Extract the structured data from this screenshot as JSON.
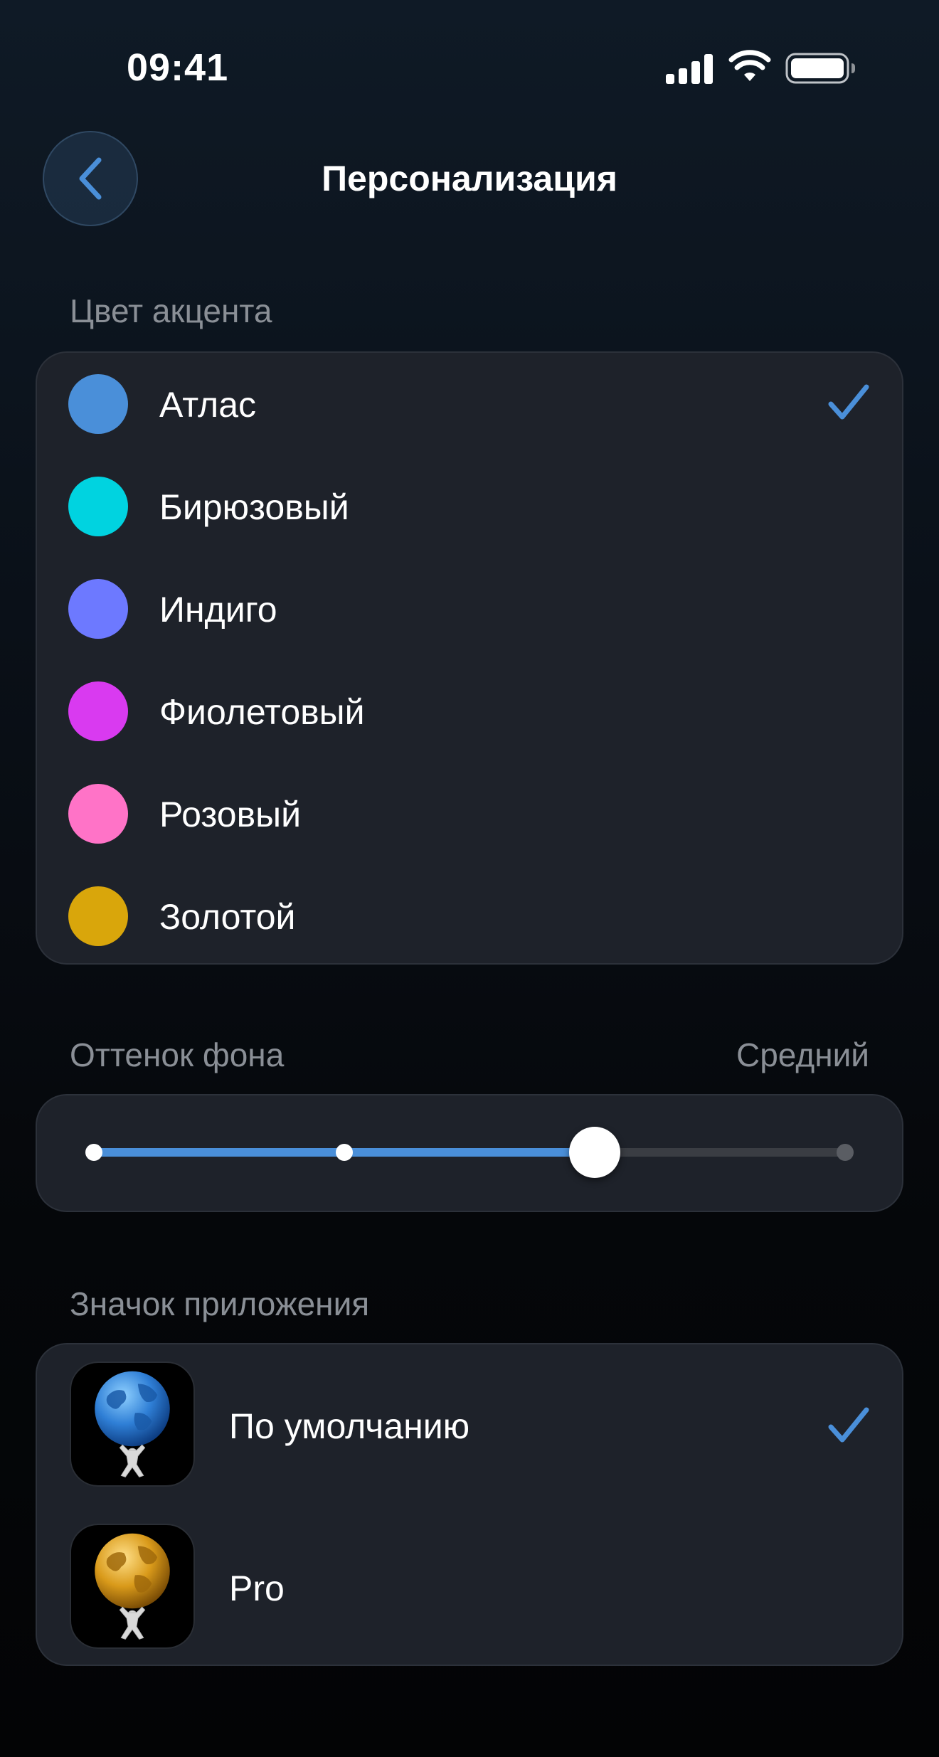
{
  "status_bar": {
    "time": "09:41"
  },
  "nav": {
    "title": "Персонализация"
  },
  "accent": {
    "section_label": "Цвет акцента",
    "selected_index": 0,
    "check_color": "#4a8fd9",
    "options": [
      {
        "label": "Атлас",
        "color": "#4a8fd9"
      },
      {
        "label": "Бирюзовый",
        "color": "#00d3e0"
      },
      {
        "label": "Индиго",
        "color": "#6d79ff"
      },
      {
        "label": "Фиолетовый",
        "color": "#d93af0"
      },
      {
        "label": "Розовый",
        "color": "#ff73c7"
      },
      {
        "label": "Золотой",
        "color": "#d9a60b"
      }
    ]
  },
  "background_tint": {
    "section_label": "Оттенок фона",
    "value_label": "Средний",
    "steps": 4,
    "selected_step": 2,
    "fill_color": "#4a8fd9"
  },
  "app_icon": {
    "section_label": "Значок приложения",
    "selected_index": 0,
    "options": [
      {
        "label": "По умолчанию",
        "icon": "atlas-blue-globe-icon"
      },
      {
        "label": "Pro",
        "icon": "atlas-gold-globe-icon"
      }
    ]
  }
}
